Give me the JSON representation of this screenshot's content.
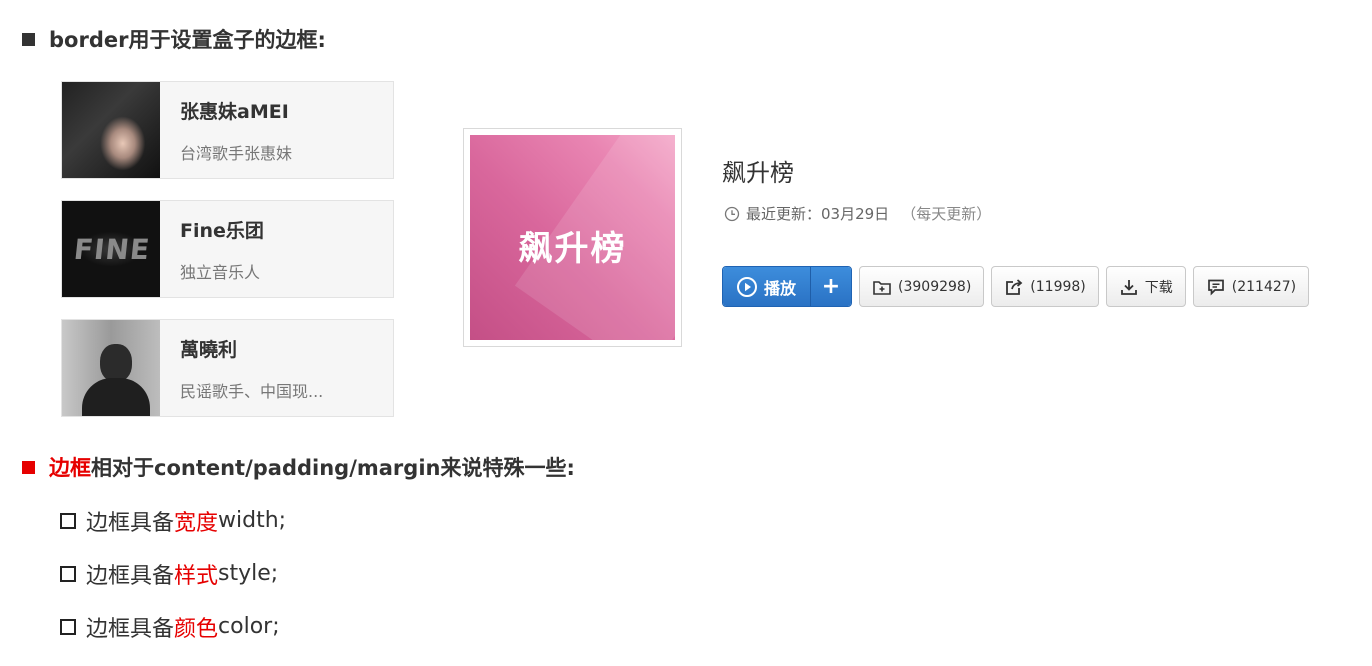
{
  "heading1": {
    "text": "border用于设置盒子的边框:"
  },
  "cards": [
    {
      "name": "张惠妹aMEI",
      "desc": "台湾歌手张惠妹"
    },
    {
      "name": "Fine乐团",
      "desc": "独立音乐人",
      "thumb_text": "FINE"
    },
    {
      "name": "萬曉利",
      "desc": "民谣歌手、中国现..."
    }
  ],
  "cover": {
    "text": "飙升榜"
  },
  "chart": {
    "title": "飙升榜",
    "update_label": "最近更新：03月29日",
    "update_note": "（每天更新）"
  },
  "buttons": {
    "play": "播放",
    "add": "+",
    "collect": "(3909298)",
    "share": "(11998)",
    "download": "下载",
    "comment": "(211427)"
  },
  "heading2": {
    "highlight": "边框",
    "rest": "相对于content/padding/margin来说特殊一些:"
  },
  "items": [
    {
      "prefix": "边框具备",
      "highlight": "宽度",
      "suffix": "width;"
    },
    {
      "prefix": "边框具备",
      "highlight": "样式",
      "suffix": "style;"
    },
    {
      "prefix": "边框具备",
      "highlight": "颜色",
      "suffix": "color;"
    }
  ],
  "colors": {
    "accent_red": "#e60000",
    "play_blue": "#2a72c4",
    "cover_pink": "#d9679c"
  }
}
